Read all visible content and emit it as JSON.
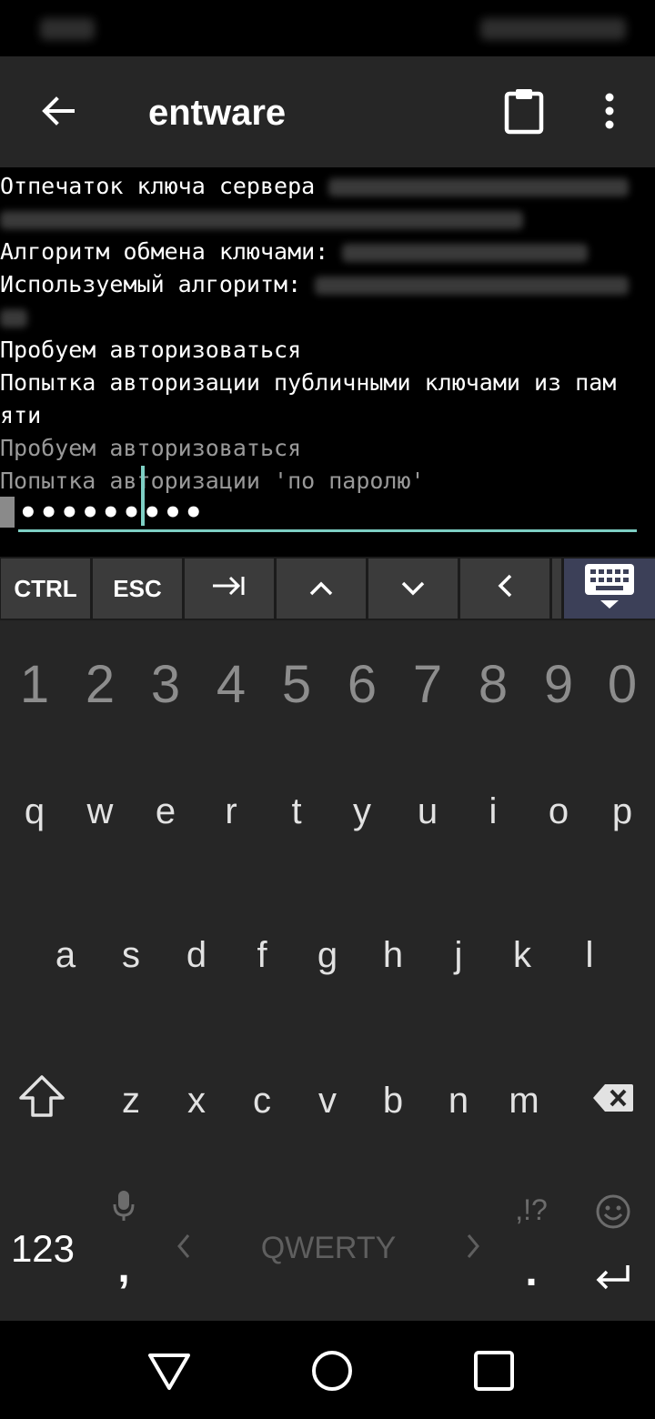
{
  "app": {
    "title": "entware",
    "back_icon": "arrow-back-icon",
    "clipboard_icon": "clipboard-icon",
    "menu_icon": "more-vert-icon"
  },
  "terminal": {
    "line1": "Отпечаток ключа сервера",
    "line3": "Алгоритм обмена ключами:",
    "line4": "Используемый алгоритм:",
    "line6": "Пробуем авторизоваться",
    "line7": "Попытка авторизации публичными ключами из пам",
    "line8": "яти",
    "line9": "Пробуем авторизоваться",
    "line10": "Попытка авторизации 'по паролю'",
    "password_mask": "•••••••••"
  },
  "extra_keys": {
    "ctrl": "CTRL",
    "esc": "ESC",
    "tab_icon": "tab-icon",
    "up_icon": "chevron-up-icon",
    "down_icon": "chevron-down-icon",
    "left_icon": "chevron-left-icon",
    "keyboard_toggle_icon": "keyboard-hide-icon"
  },
  "keyboard": {
    "numbers": [
      "1",
      "2",
      "3",
      "4",
      "5",
      "6",
      "7",
      "8",
      "9",
      "0"
    ],
    "row1": [
      "q",
      "w",
      "e",
      "r",
      "t",
      "y",
      "u",
      "i",
      "o",
      "p"
    ],
    "row2": [
      "a",
      "s",
      "d",
      "f",
      "g",
      "h",
      "j",
      "k",
      "l"
    ],
    "row3": [
      "z",
      "x",
      "c",
      "v",
      "b",
      "n",
      "m"
    ],
    "symbols_key": "123",
    "comma_key": ",",
    "layout_label": "QWERTY",
    "punct_hint": ",!?",
    "period_key": "."
  },
  "colors": {
    "accent": "#7ecfc4",
    "appbar_bg": "#262626",
    "keyboard_bg": "#262626",
    "extra_key_bg": "#3b3b3b",
    "keyboard_toggle_bg": "#3c4058"
  }
}
